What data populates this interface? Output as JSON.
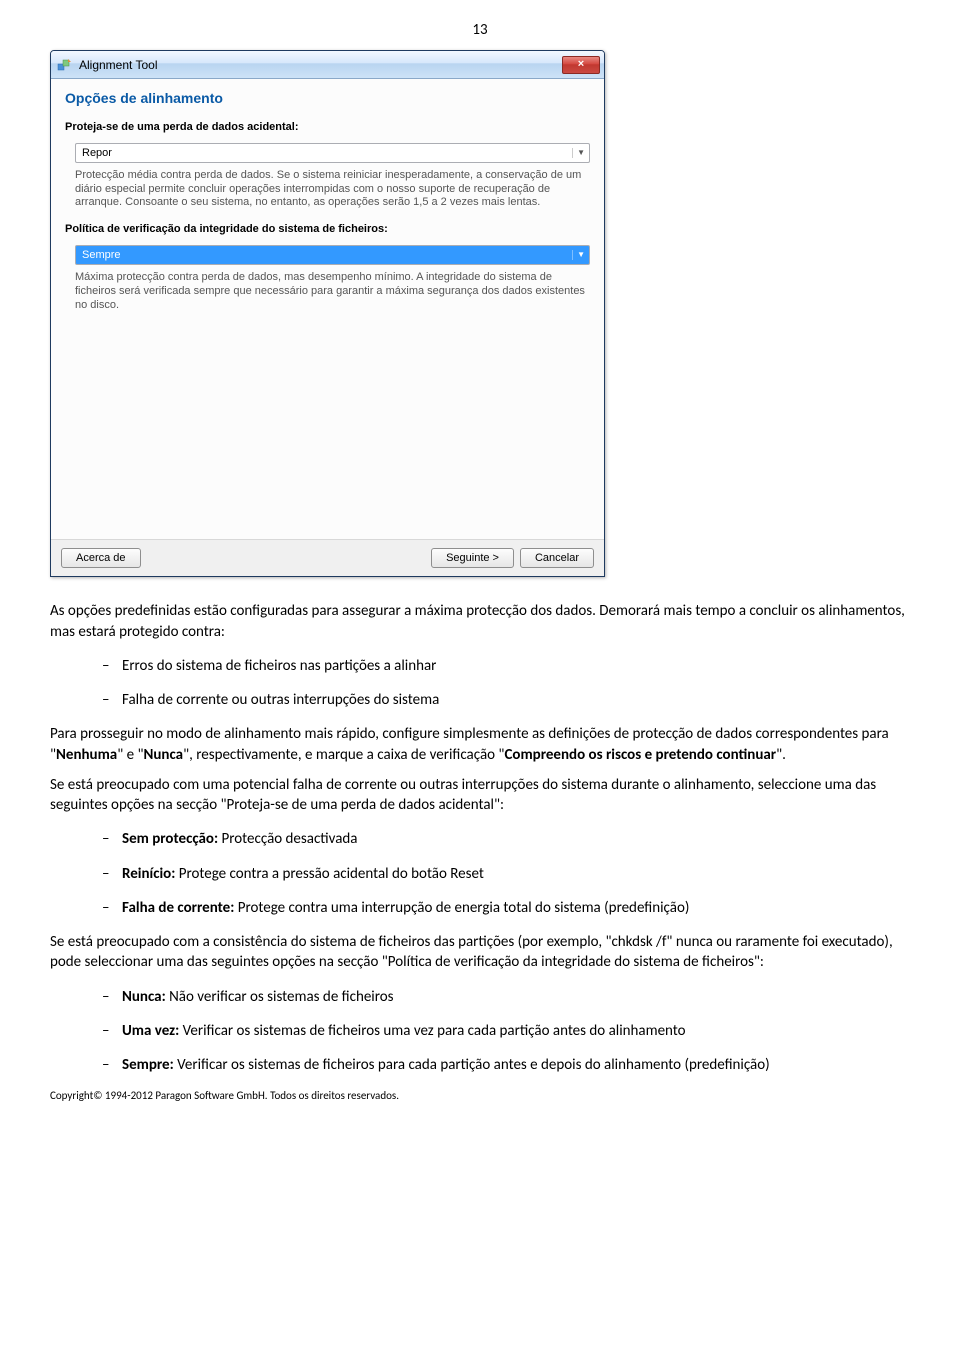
{
  "page_number": "13",
  "dialog": {
    "window_title": "Alignment Tool",
    "close_label": "×",
    "heading": "Opções de alinhamento",
    "section1_label": "Proteja-se de uma perda de dados acidental:",
    "combo1_value": "Repor",
    "desc1": "Protecção média contra perda de dados. Se o sistema reiniciar inesperadamente, a conservação de um diário especial permite concluir operações interrompidas com o nosso suporte de recuperação de arranque. Consoante o seu sistema, no entanto, as operações serão 1,5 a 2 vezes mais lentas.",
    "section2_label": "Política de verificação da integridade do sistema de ficheiros:",
    "combo2_value": "Sempre",
    "desc2": "Máxima protecção contra perda de dados, mas desempenho mínimo. A integridade do sistema de ficheiros será verificada sempre que necessário para garantir a máxima segurança dos dados existentes no disco.",
    "btn_about": "Acerca de",
    "btn_next": "Seguinte >",
    "btn_cancel": "Cancelar"
  },
  "doc": {
    "p1": "As opções predefinidas estão configuradas para assegurar a máxima protecção dos dados. Demorará mais tempo a concluir os alinhamentos, mas estará protegido contra:",
    "list1": {
      "i1": "Erros do sistema de ficheiros nas partições a alinhar",
      "i2": "Falha de corrente ou outras interrupções do sistema"
    },
    "p2a": "Para prosseguir no modo de alinhamento mais rápido, configure simplesmente as definições de protecção de dados correspondentes para \"",
    "p2b": "Nenhuma",
    "p2c": "\" e \"",
    "p2d": "Nunca",
    "p2e": "\", respectivamente, e marque a caixa de verificação \"",
    "p2f": "Compreendo os riscos e pretendo continuar",
    "p2g": "\".",
    "p3": "Se está preocupado com uma potencial falha de corrente ou outras interrupções do sistema durante o alinhamento, seleccione uma das seguintes opções na secção \"Proteja-se de uma perda de dados acidental\":",
    "list2": {
      "i1a": "Sem protecção:",
      "i1b": " Protecção desactivada",
      "i2a": "Reinício:",
      "i2b": " Protege contra a pressão acidental do botão Reset",
      "i3a": "Falha de corrente:",
      "i3b": " Protege contra uma interrupção de energia total do sistema (predefinição)"
    },
    "p4": "Se está preocupado com a consistência do sistema de ficheiros das partições (por exemplo, \"chkdsk /f\" nunca ou raramente foi executado), pode seleccionar uma das seguintes opções na secção \"Política de verificação da integridade do sistema de ficheiros\":",
    "list3": {
      "i1a": "Nunca:",
      "i1b": " Não verificar os sistemas de ficheiros",
      "i2a": "Uma vez:",
      "i2b": " Verificar os sistemas de ficheiros uma vez para cada partição antes do alinhamento",
      "i3a": "Sempre:",
      "i3b": " Verificar os sistemas de ficheiros para cada partição antes e depois do alinhamento (predefinição)"
    },
    "copyright": "Copyright© 1994-2012 Paragon Software GmbH. Todos os direitos reservados."
  }
}
